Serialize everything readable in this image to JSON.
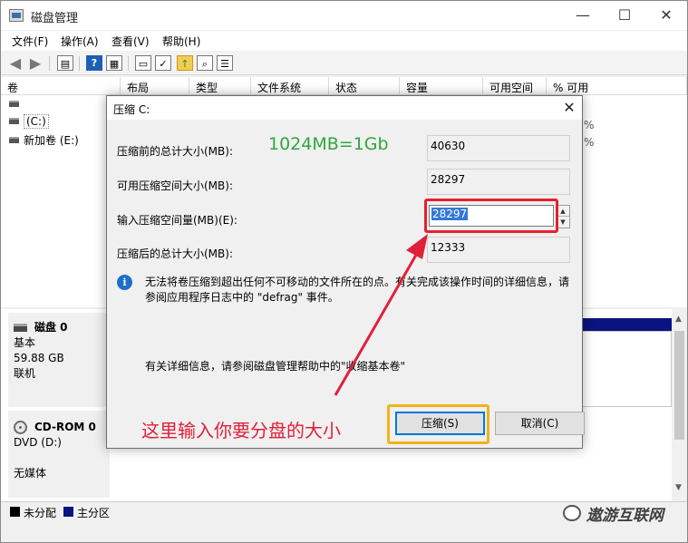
{
  "window": {
    "title": "磁盘管理",
    "min": "—",
    "max": "☐",
    "close": "✕"
  },
  "menu": [
    "文件(F)",
    "操作(A)",
    "查看(V)",
    "帮助(H)"
  ],
  "toolbar": {
    "help_glyph": "?"
  },
  "volume_list": {
    "columns": [
      "卷",
      "布局",
      "类型",
      "文件系统",
      "状态",
      "容量",
      "可用空间",
      "% 可用"
    ],
    "rows": [
      "",
      "(C:)",
      "新加卷 (E:)"
    ],
    "partial_right": [
      "%",
      "%"
    ]
  },
  "disks": [
    {
      "name": "磁盘 0",
      "type": "基本",
      "size": "59.88 GB",
      "status": "联机"
    },
    {
      "name": "CD-ROM 0",
      "type": "DVD (D:)",
      "size": "",
      "status": "无媒体"
    }
  ],
  "legend": [
    {
      "label": "未分配",
      "color": "#000000"
    },
    {
      "label": "主分区",
      "color": "#0a1480"
    }
  ],
  "watermark": "遨游互联网",
  "dialog": {
    "title": "压缩 C:",
    "close": "✕",
    "labels": {
      "total_before": "压缩前的总计大小(MB):",
      "available": "可用压缩空间大小(MB):",
      "amount": "输入压缩空间量(MB)(E):",
      "total_after": "压缩后的总计大小(MB):"
    },
    "values": {
      "total_before": "40630",
      "available": "28297",
      "amount": "28297",
      "total_after": "12333"
    },
    "info_icon": "i",
    "info_text": "无法将卷压缩到超出任何不可移动的文件所在的点。有关完成该操作时间的详细信息，请参阅应用程序日志中的 \"defrag\" 事件。",
    "help_text": "有关详细信息，请参阅磁盘管理帮助中的\"收缩基本卷\"",
    "buttons": {
      "shrink": "压缩(S)",
      "cancel": "取消(C)"
    }
  },
  "annotations": {
    "green": "1024MB=1Gb",
    "red": "这里输入你要分盘的大小",
    "colors": {
      "green": "#2ea83b",
      "red": "#e0203a",
      "highlight_input": "#e8202e",
      "highlight_button": "#f2b21b"
    }
  }
}
